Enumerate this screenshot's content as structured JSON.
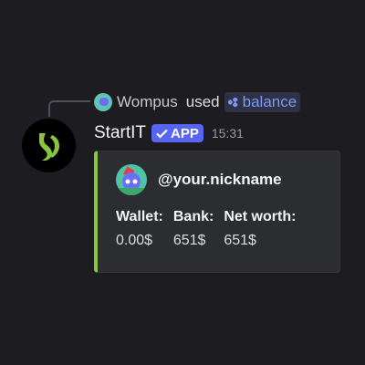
{
  "reply": {
    "username": "Wompus",
    "used_text": "used",
    "command": "balance"
  },
  "message": {
    "username": "StartIT",
    "badge": "APP",
    "timestamp": "15:31"
  },
  "embed": {
    "accent_color": "#8ac43f",
    "author": "@your.nickname",
    "fields": [
      {
        "name": "Wallet:",
        "value": "0.00$"
      },
      {
        "name": "Bank:",
        "value": "651$"
      },
      {
        "name": "Net worth:",
        "value": "651$"
      }
    ]
  },
  "colors": {
    "background": "#1d1d21",
    "badge": "#5865f2",
    "command_pill_text": "#7b9cf2",
    "avatar_logo": "#8ac43f"
  },
  "icons": [
    "wompus-avatar-icon",
    "slash-command-icon",
    "startit-logo-icon",
    "checkmark-icon",
    "discord-avatar-icon"
  ]
}
